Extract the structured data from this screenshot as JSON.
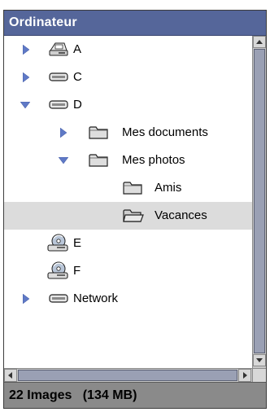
{
  "window": {
    "title": "Ordinateur"
  },
  "tree": {
    "items": [
      {
        "label": "A",
        "icon": "floppy-drive-icon",
        "expanded": false
      },
      {
        "label": "C",
        "icon": "hard-drive-icon",
        "expanded": false
      },
      {
        "label": "D",
        "icon": "hard-drive-icon",
        "expanded": true
      },
      {
        "label": "Mes documents",
        "icon": "folder-icon",
        "expanded": false
      },
      {
        "label": "Mes photos",
        "icon": "folder-icon",
        "expanded": true
      },
      {
        "label": "Amis",
        "icon": "folder-icon"
      },
      {
        "label": "Vacances",
        "icon": "folder-open-icon",
        "selected": true
      },
      {
        "label": "E",
        "icon": "cd-drive-icon"
      },
      {
        "label": "F",
        "icon": "cd-drive-icon"
      },
      {
        "label": "Network",
        "icon": "network-drive-icon",
        "expanded": false
      }
    ]
  },
  "status": {
    "text": "22 Images   (134 MB)"
  },
  "colors": {
    "titlebar": "#55669a",
    "triangle": "#5f79c6",
    "selection": "#dcdcdc",
    "statusbar": "#8a8a8a"
  }
}
